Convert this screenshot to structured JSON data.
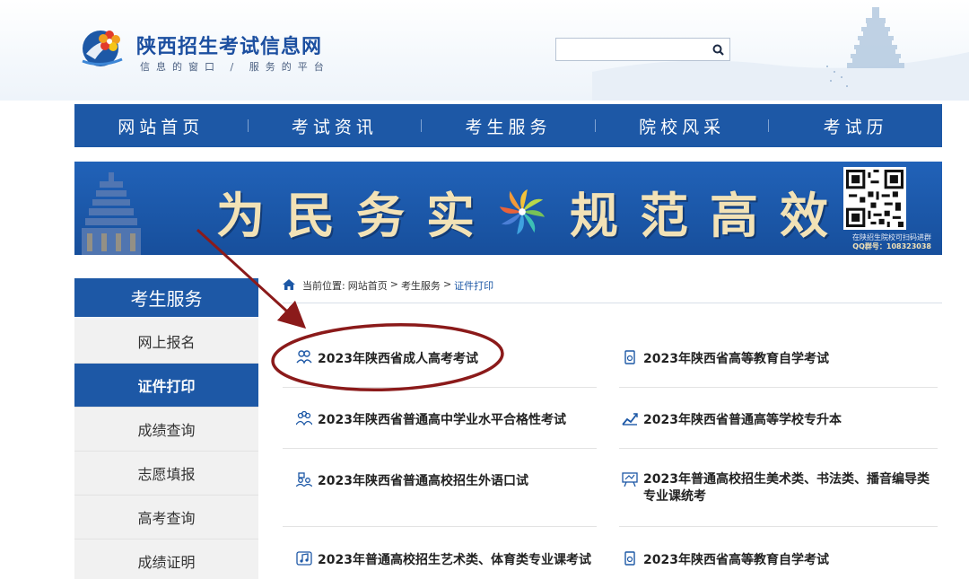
{
  "header": {
    "site_title": "陕西招生考试信息网",
    "slogan": "信息的窗口 / 服务的平台",
    "search": {
      "placeholder": "",
      "value": ""
    }
  },
  "nav": {
    "items": [
      {
        "label": "网站首页"
      },
      {
        "label": "考试资讯"
      },
      {
        "label": "考生服务"
      },
      {
        "label": "院校风采"
      },
      {
        "label": "考试历"
      }
    ]
  },
  "banner": {
    "chars_left": [
      "为",
      "民",
      "务",
      "实"
    ],
    "chars_right": [
      "规",
      "范",
      "高",
      "效"
    ],
    "qr_note_line1": "在陕招生院校可扫码进群",
    "qr_note_line2": "QQ群号：108323038"
  },
  "sidebar": {
    "title": "考生服务",
    "items": [
      {
        "label": "网上报名"
      },
      {
        "label": "证件打印"
      },
      {
        "label": "成绩查询"
      },
      {
        "label": "志愿填报"
      },
      {
        "label": "高考查询"
      },
      {
        "label": "成绩证明"
      }
    ],
    "active": "证件打印"
  },
  "breadcrumb": {
    "prefix": "当前位置:",
    "items": [
      "网站首页",
      "考生服务",
      "证件打印"
    ],
    "separator": ">"
  },
  "exams": [
    {
      "label": "2023年陕西省成人高考考试",
      "icon": "people-icon"
    },
    {
      "label": "2023年陕西省高等教育自学考试",
      "icon": "document-icon"
    },
    {
      "label": "2023年陕西省普通高中学业水平合格性考试",
      "icon": "group-icon"
    },
    {
      "label": "2023年陕西省普通高等学校专升本",
      "icon": "chart-icon"
    },
    {
      "label": "2023年陕西省普通高校招生外语口试",
      "icon": "group-icon"
    },
    {
      "label": "2023年普通高校招生美术类、书法类、播音编导类专业课统考",
      "icon": "easel-icon"
    },
    {
      "label": "2023年普通高校招生艺术类、体育类专业课考试",
      "icon": "music-icon"
    },
    {
      "label": "2023年陕西省高等教育自学考试",
      "icon": "document-icon"
    }
  ],
  "colors": {
    "primary_blue": "#1d58a6",
    "annotation_red": "#8b1a1a",
    "banner_text": "#f2e2b6"
  }
}
